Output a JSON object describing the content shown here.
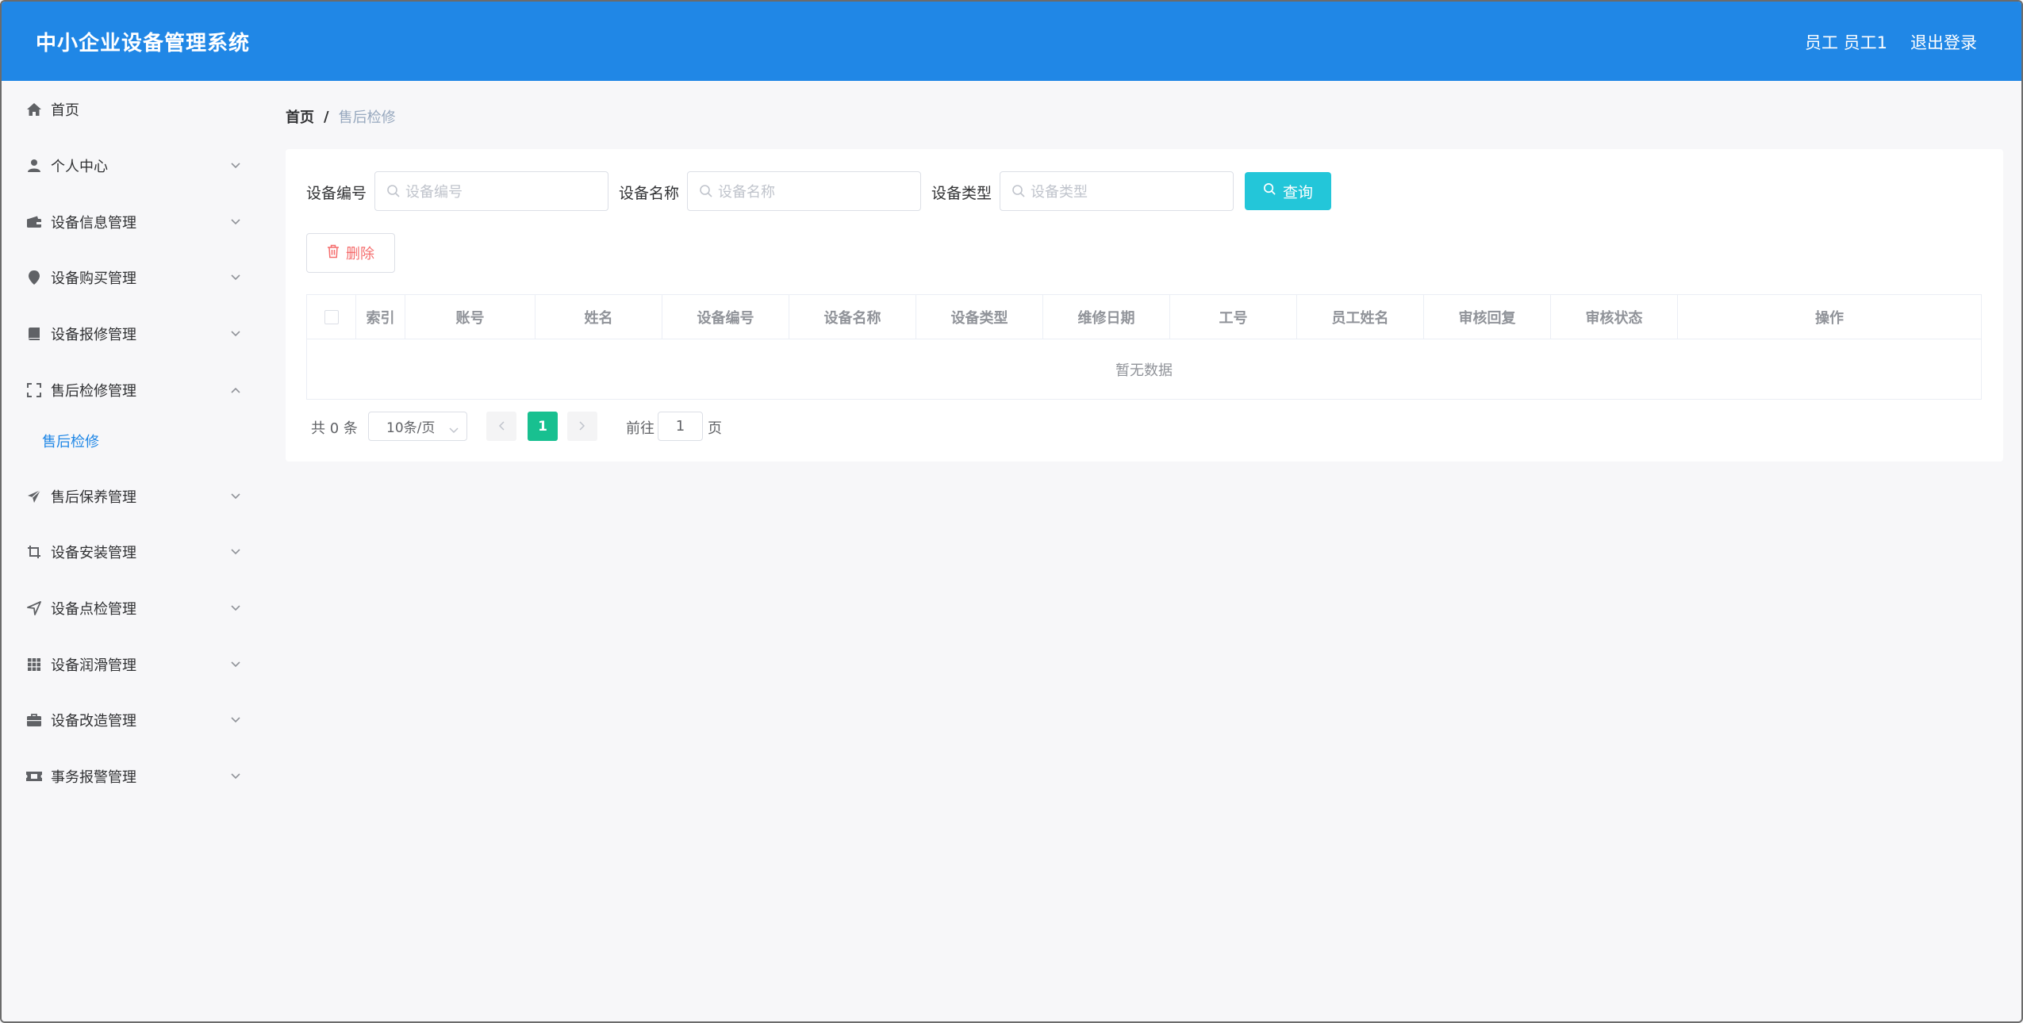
{
  "header": {
    "title": "中小企业设备管理系统",
    "user": "员工 员工1",
    "logout": "退出登录"
  },
  "sidebar": {
    "items": [
      {
        "label": "首页",
        "icon": "home-icon",
        "has_arrow": false
      },
      {
        "label": "个人中心",
        "icon": "user-icon",
        "has_arrow": true,
        "arrow": "down"
      },
      {
        "label": "设备信息管理",
        "icon": "wallet-icon",
        "has_arrow": true,
        "arrow": "down"
      },
      {
        "label": "设备购买管理",
        "icon": "map-pin-icon",
        "has_arrow": true,
        "arrow": "down"
      },
      {
        "label": "设备报修管理",
        "icon": "book-icon",
        "has_arrow": true,
        "arrow": "down"
      },
      {
        "label": "售后检修管理",
        "icon": "fullscreen-icon",
        "has_arrow": true,
        "arrow": "up"
      },
      {
        "label": "售后保养管理",
        "icon": "send-icon",
        "has_arrow": true,
        "arrow": "down"
      },
      {
        "label": "设备安装管理",
        "icon": "crop-icon",
        "has_arrow": true,
        "arrow": "down"
      },
      {
        "label": "设备点检管理",
        "icon": "location-arrow-icon",
        "has_arrow": true,
        "arrow": "down"
      },
      {
        "label": "设备润滑管理",
        "icon": "grid-icon",
        "has_arrow": true,
        "arrow": "down"
      },
      {
        "label": "设备改造管理",
        "icon": "briefcase-icon",
        "has_arrow": true,
        "arrow": "down"
      },
      {
        "label": "事务报警管理",
        "icon": "ticket-icon",
        "has_arrow": true,
        "arrow": "down"
      }
    ],
    "sub_item": "售后检修"
  },
  "breadcrumb": {
    "home": "首页",
    "separator": "/",
    "current": "售后检修"
  },
  "search": {
    "fields": [
      {
        "label": "设备编号",
        "placeholder": "设备编号"
      },
      {
        "label": "设备名称",
        "placeholder": "设备名称"
      },
      {
        "label": "设备类型",
        "placeholder": "设备类型"
      }
    ],
    "query_label": "查询"
  },
  "toolbar": {
    "delete_label": "删除"
  },
  "table": {
    "columns": [
      "索引",
      "账号",
      "姓名",
      "设备编号",
      "设备名称",
      "设备类型",
      "维修日期",
      "工号",
      "员工姓名",
      "审核回复",
      "审核状态",
      "操作"
    ],
    "empty_text": "暂无数据"
  },
  "pagination": {
    "total": "共 0 条",
    "page_size": "10条/页",
    "current_page": "1",
    "goto_label": "前往",
    "goto_value": "1",
    "page_label": "页"
  },
  "colors": {
    "header_bg": "#2087e6",
    "query_button": "#23c6d9",
    "active_page": "#18c090",
    "delete_text": "#f56c6c"
  }
}
